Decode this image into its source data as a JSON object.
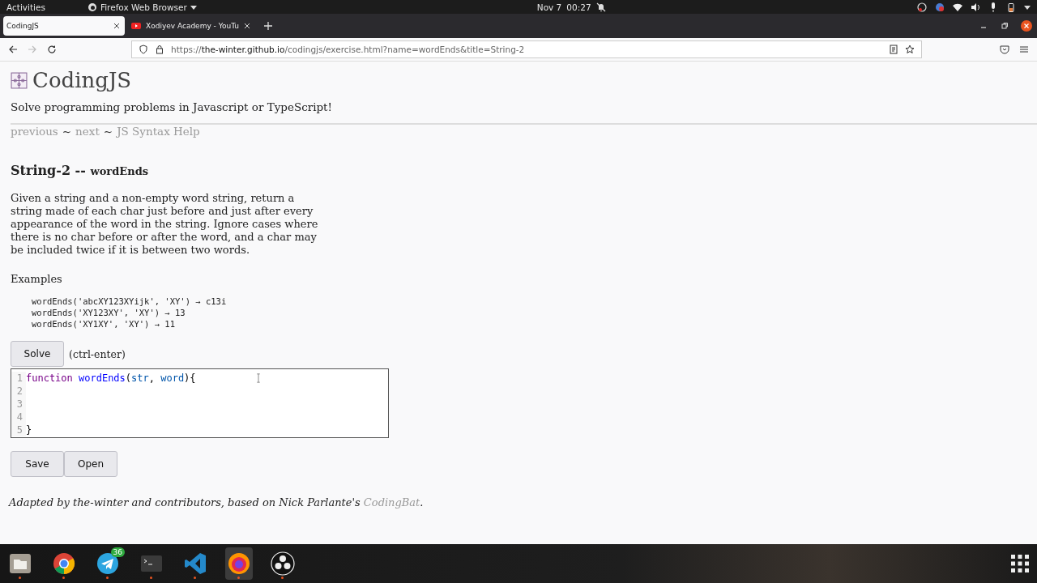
{
  "top_bar": {
    "activities": "Activities",
    "app_menu": "Firefox Web Browser",
    "date": "Nov 7",
    "time": "00:27"
  },
  "tabs": [
    {
      "title": "CodingJS",
      "selected": true,
      "kind": "page"
    },
    {
      "title": "Xodiyev Academy - YouTu",
      "selected": false,
      "kind": "video"
    }
  ],
  "url": {
    "scheme": "https://",
    "host": "the-winter.github.io",
    "path": "/codingjs/exercise.html?name=wordEnds&title=String-2"
  },
  "site_title": "CodingJS",
  "tagline": "Solve programming problems in Javascript or TypeScript!",
  "nav": [
    {
      "kind": "link",
      "text": "previous"
    },
    {
      "kind": "sep",
      "text": "~"
    },
    {
      "kind": "link",
      "text": "next"
    },
    {
      "kind": "sep",
      "text": "~"
    },
    {
      "kind": "link",
      "text": "JS Syntax Help"
    }
  ],
  "problem": {
    "category": "String-2 --",
    "name": "wordEnds"
  },
  "description": "Given a string and a non-empty word string, return a string made of each char just before and just after every appearance of the word in the string. Ignore cases where there is no char before or after the word, and a char may be included twice if it is between two words.",
  "examples_heading": "Examples",
  "examples": [
    "wordEnds('abcXY123XYijk', 'XY') → c13i",
    "wordEnds('XY123XY', 'XY') → 13",
    "wordEnds('XY1XY', 'XY') → 11"
  ],
  "solve_button": "Solve",
  "shortcut": "(ctrl-enter)",
  "editor": [
    {
      "number": "1",
      "tokens": [
        {
          "kind": "keyword",
          "text": "function"
        },
        {
          "kind": "def",
          "text": " wordEnds"
        },
        {
          "kind": "plain",
          "text": "("
        },
        {
          "kind": "var",
          "text": "str"
        },
        {
          "kind": "plain",
          "text": ", "
        },
        {
          "kind": "var",
          "text": "word"
        },
        {
          "kind": "plain",
          "text": "){"
        }
      ]
    },
    {
      "number": "2"
    },
    {
      "number": "3"
    },
    {
      "number": "4"
    },
    {
      "number": "5",
      "tokens": [
        {
          "kind": "plain",
          "text": "}"
        }
      ]
    }
  ],
  "buttons": [
    "Save",
    "Open"
  ],
  "footer": {
    "text": "Adapted by the-winter and contributors, based on Nick Parlante's ",
    "link": "CodingBat",
    "end": "."
  },
  "dock": [
    {
      "kind": "files",
      "selected": false
    },
    {
      "kind": "chrome",
      "selected": false
    },
    {
      "kind": "telegram",
      "selected": false,
      "badge": "36"
    },
    {
      "kind": "terminal",
      "selected": false
    },
    {
      "kind": "vscode",
      "selected": false
    },
    {
      "kind": "firefox",
      "selected": true
    },
    {
      "kind": "obs",
      "selected": false
    }
  ]
}
